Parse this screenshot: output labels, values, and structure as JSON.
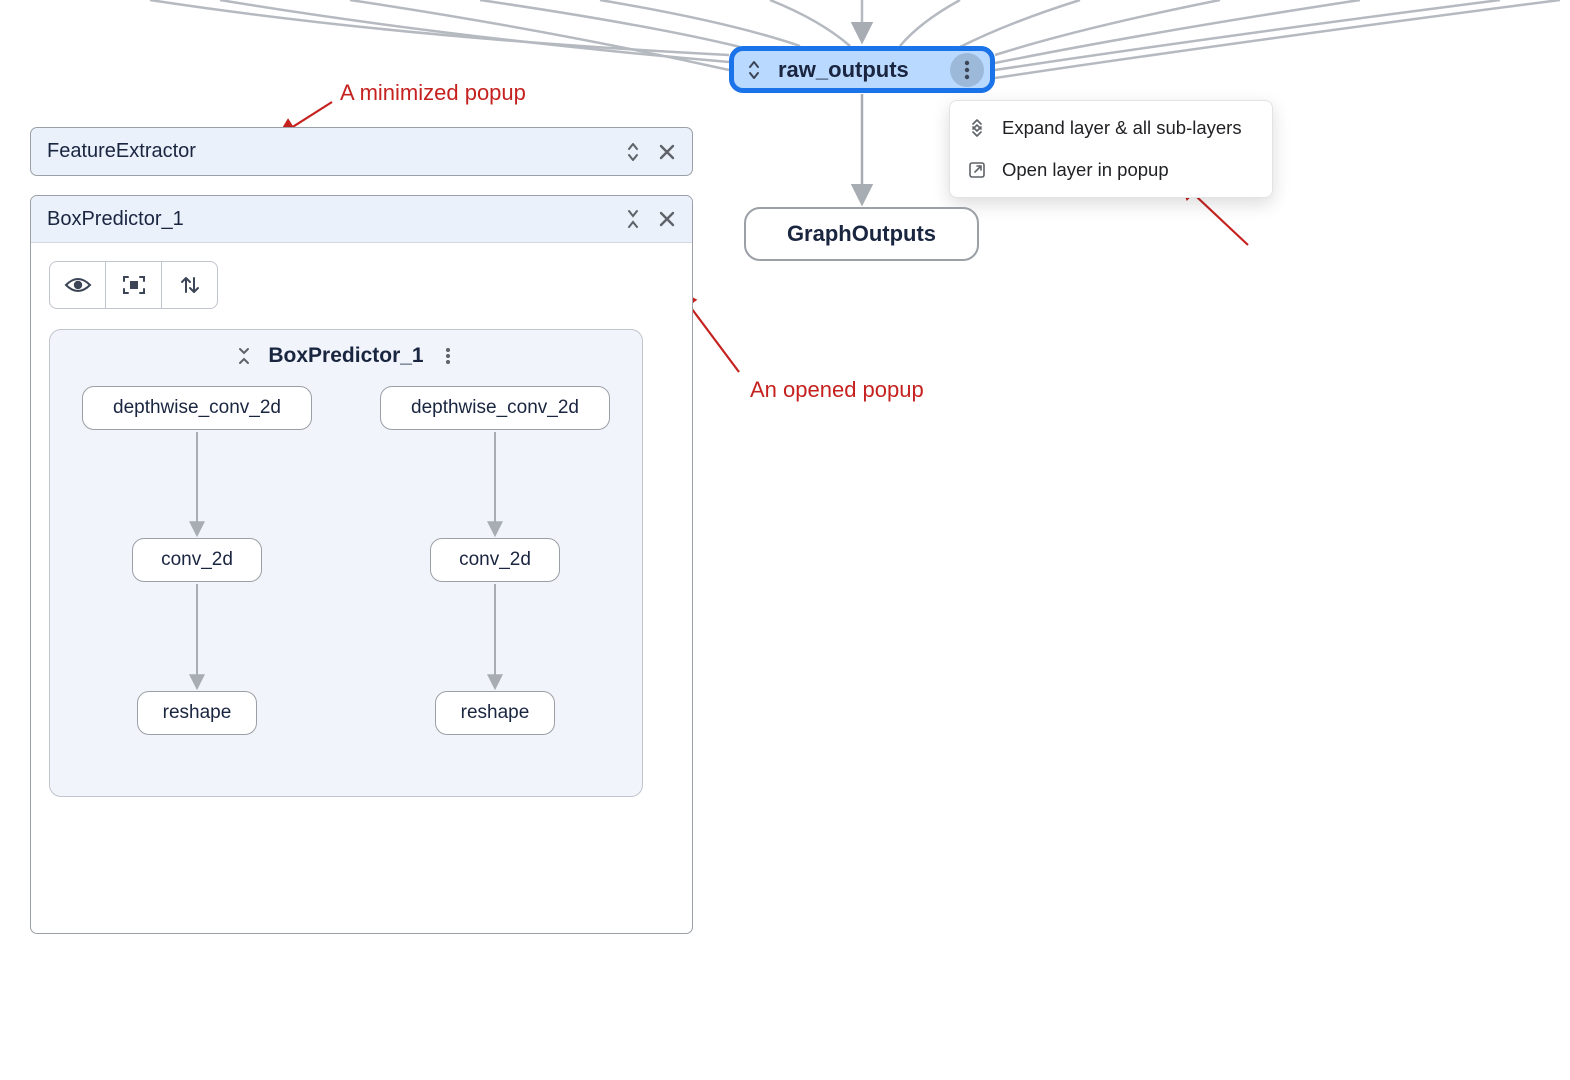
{
  "annotations": {
    "minimized_popup": "A minimized popup",
    "opened_popup": "An opened popup"
  },
  "graph": {
    "selected_node": "raw_outputs",
    "output_node": "GraphOutputs"
  },
  "context_menu": {
    "expand_all": "Expand layer & all sub-layers",
    "open_popup": "Open layer in popup"
  },
  "popups": {
    "minimized": {
      "title": "FeatureExtractor"
    },
    "opened": {
      "title": "BoxPredictor_1",
      "inner_title": "BoxPredictor_1",
      "columns": [
        {
          "n1": "depthwise_conv_2d",
          "n2": "conv_2d",
          "n3": "reshape"
        },
        {
          "n1": "depthwise_conv_2d",
          "n2": "conv_2d",
          "n3": "reshape"
        }
      ]
    }
  }
}
